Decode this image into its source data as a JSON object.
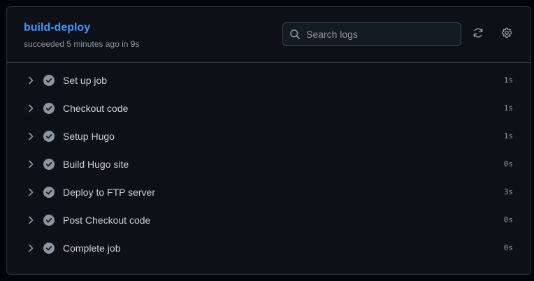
{
  "job": {
    "title": "build-deploy",
    "status": "succeeded 5 minutes ago in 9s"
  },
  "search": {
    "placeholder": "Search logs"
  },
  "icons": {
    "search": "search-icon",
    "refresh": "refresh-icon",
    "settings": "gear-icon",
    "expand": "chevron-right-icon",
    "success": "check-circle-fill-icon"
  },
  "colors": {
    "accent": "#4493f8",
    "success_icon": "#8d96a0"
  },
  "steps": [
    {
      "name": "Set up job",
      "duration": "1s"
    },
    {
      "name": "Checkout code",
      "duration": "1s"
    },
    {
      "name": "Setup Hugo",
      "duration": "1s"
    },
    {
      "name": "Build Hugo site",
      "duration": "0s"
    },
    {
      "name": "Deploy to FTP server",
      "duration": "3s"
    },
    {
      "name": "Post Checkout code",
      "duration": "0s"
    },
    {
      "name": "Complete job",
      "duration": "0s"
    }
  ]
}
